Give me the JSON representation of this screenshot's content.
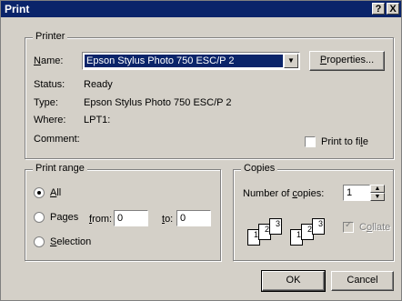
{
  "title": "Print",
  "titlebar_buttons": {
    "help": "?",
    "close": "X"
  },
  "printer": {
    "legend": "Printer",
    "name_label": "Name:",
    "name_value": "Epson Stylus Photo 750 ESC/P 2",
    "properties_label": "Properties...",
    "status_label": "Status:",
    "status_value": "Ready",
    "type_label": "Type:",
    "type_value": "Epson Stylus Photo 750 ESC/P 2",
    "where_label": "Where:",
    "where_value": "LPT1:",
    "comment_label": "Comment:",
    "print_to_file_label": "Print to file"
  },
  "print_range": {
    "legend": "Print range",
    "all_label": "All",
    "pages_label": "Pages",
    "from_label": "from:",
    "from_value": "0",
    "to_label": "to:",
    "to_value": "0",
    "selection_label": "Selection",
    "selected": "all"
  },
  "copies": {
    "legend": "Copies",
    "number_label": "Number of copies:",
    "number_value": "1",
    "collate_label": "Collate",
    "collate_checked": true
  },
  "buttons": {
    "ok": "OK",
    "cancel": "Cancel"
  }
}
